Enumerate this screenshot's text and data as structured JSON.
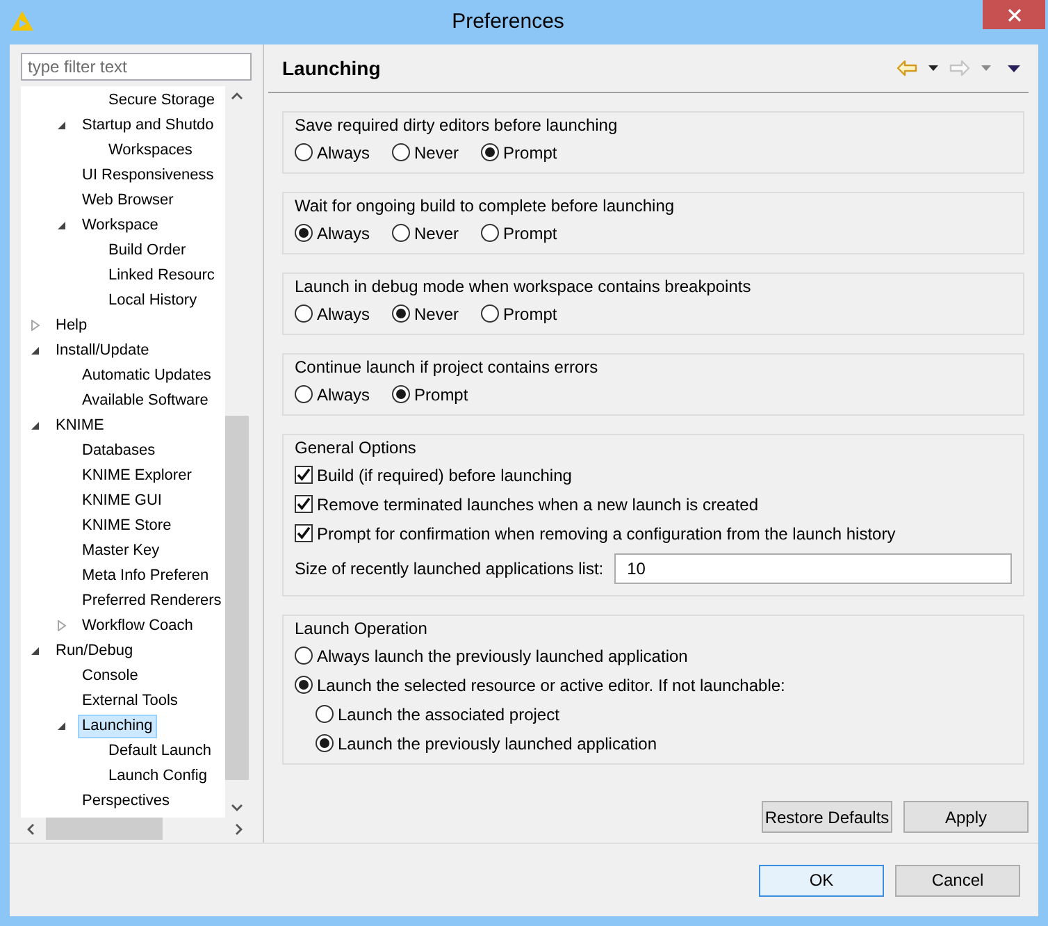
{
  "window": {
    "title": "Preferences"
  },
  "sidebar": {
    "filter": {
      "placeholder": "type filter text"
    },
    "tree": [
      {
        "children": [
          {
            "children": [
              {
                "label": "Secure Storage",
                "selected": false
              }
            ]
          },
          {
            "label": "Startup and Shutdo",
            "selected": false,
            "expanded": true,
            "children": [
              {
                "label": "Workspaces",
                "selected": false
              }
            ]
          },
          {
            "label": "UI Responsiveness",
            "selected": false
          },
          {
            "label": "Web Browser",
            "selected": false
          },
          {
            "label": "Workspace",
            "selected": false,
            "expanded": true,
            "children": [
              {
                "label": "Build Order",
                "selected": false
              },
              {
                "label": "Linked Resourc",
                "selected": false
              },
              {
                "label": "Local History",
                "selected": false
              }
            ]
          }
        ]
      },
      {
        "label": "Help",
        "selected": false,
        "expanded": false
      },
      {
        "label": "Install/Update",
        "selected": false,
        "expanded": true,
        "children": [
          {
            "label": "Automatic Updates",
            "selected": false
          },
          {
            "label": "Available Software",
            "selected": false
          }
        ]
      },
      {
        "label": "KNIME",
        "selected": false,
        "expanded": true,
        "children": [
          {
            "label": "Databases",
            "selected": false
          },
          {
            "label": "KNIME Explorer",
            "selected": false
          },
          {
            "label": "KNIME GUI",
            "selected": false
          },
          {
            "label": "KNIME Store",
            "selected": false
          },
          {
            "label": "Master Key",
            "selected": false
          },
          {
            "label": "Meta Info Preferen",
            "selected": false
          },
          {
            "label": "Preferred Renderers",
            "selected": false
          },
          {
            "label": "Workflow Coach",
            "selected": false,
            "expanded": false
          }
        ]
      },
      {
        "label": "Run/Debug",
        "selected": false,
        "expanded": true,
        "children": [
          {
            "label": "Console",
            "selected": false
          },
          {
            "label": "External Tools",
            "selected": false
          },
          {
            "label": "Launching",
            "selected": true,
            "expanded": true,
            "children": [
              {
                "label": "Default Launch",
                "selected": false
              },
              {
                "label": "Launch Config",
                "selected": false
              }
            ]
          },
          {
            "label": "Perspectives",
            "selected": false
          }
        ]
      }
    ]
  },
  "page": {
    "title": "Launching",
    "radio_groups": [
      {
        "title": "Save required dirty editors before launching",
        "options": [
          {
            "label": "Always",
            "selected": false
          },
          {
            "label": "Never",
            "selected": false
          },
          {
            "label": "Prompt",
            "selected": true
          }
        ]
      },
      {
        "title": "Wait for ongoing build to complete before launching",
        "options": [
          {
            "label": "Always",
            "selected": true
          },
          {
            "label": "Never",
            "selected": false
          },
          {
            "label": "Prompt",
            "selected": false
          }
        ]
      },
      {
        "title": "Launch in debug mode when workspace contains breakpoints",
        "options": [
          {
            "label": "Always",
            "selected": false
          },
          {
            "label": "Never",
            "selected": true
          },
          {
            "label": "Prompt",
            "selected": false
          }
        ]
      },
      {
        "title": "Continue launch if project contains errors",
        "options": [
          {
            "label": "Always",
            "selected": false
          },
          {
            "label": "Prompt",
            "selected": true
          }
        ]
      }
    ],
    "general_options": {
      "title": "General Options",
      "checkboxes": [
        {
          "label": "Build (if required) before launching",
          "checked": true
        },
        {
          "label": "Remove terminated launches when a new launch is created",
          "checked": true
        },
        {
          "label": "Prompt for confirmation when removing a configuration from the launch history",
          "checked": true
        }
      ],
      "size_field": {
        "label": "Size of recently launched applications list:",
        "value": "10"
      }
    },
    "launch_operation": {
      "title": "Launch Operation",
      "options": [
        {
          "label": "Always launch the previously launched application",
          "selected": false
        },
        {
          "label": "Launch the selected resource or active editor. If not launchable:",
          "selected": true,
          "children": [
            {
              "label": "Launch the associated project",
              "selected": false
            },
            {
              "label": "Launch the previously launched application",
              "selected": true
            }
          ]
        }
      ]
    },
    "buttons": {
      "restore": "Restore Defaults",
      "apply": "Apply"
    }
  },
  "dialog_buttons": {
    "ok": "OK",
    "cancel": "Cancel"
  }
}
